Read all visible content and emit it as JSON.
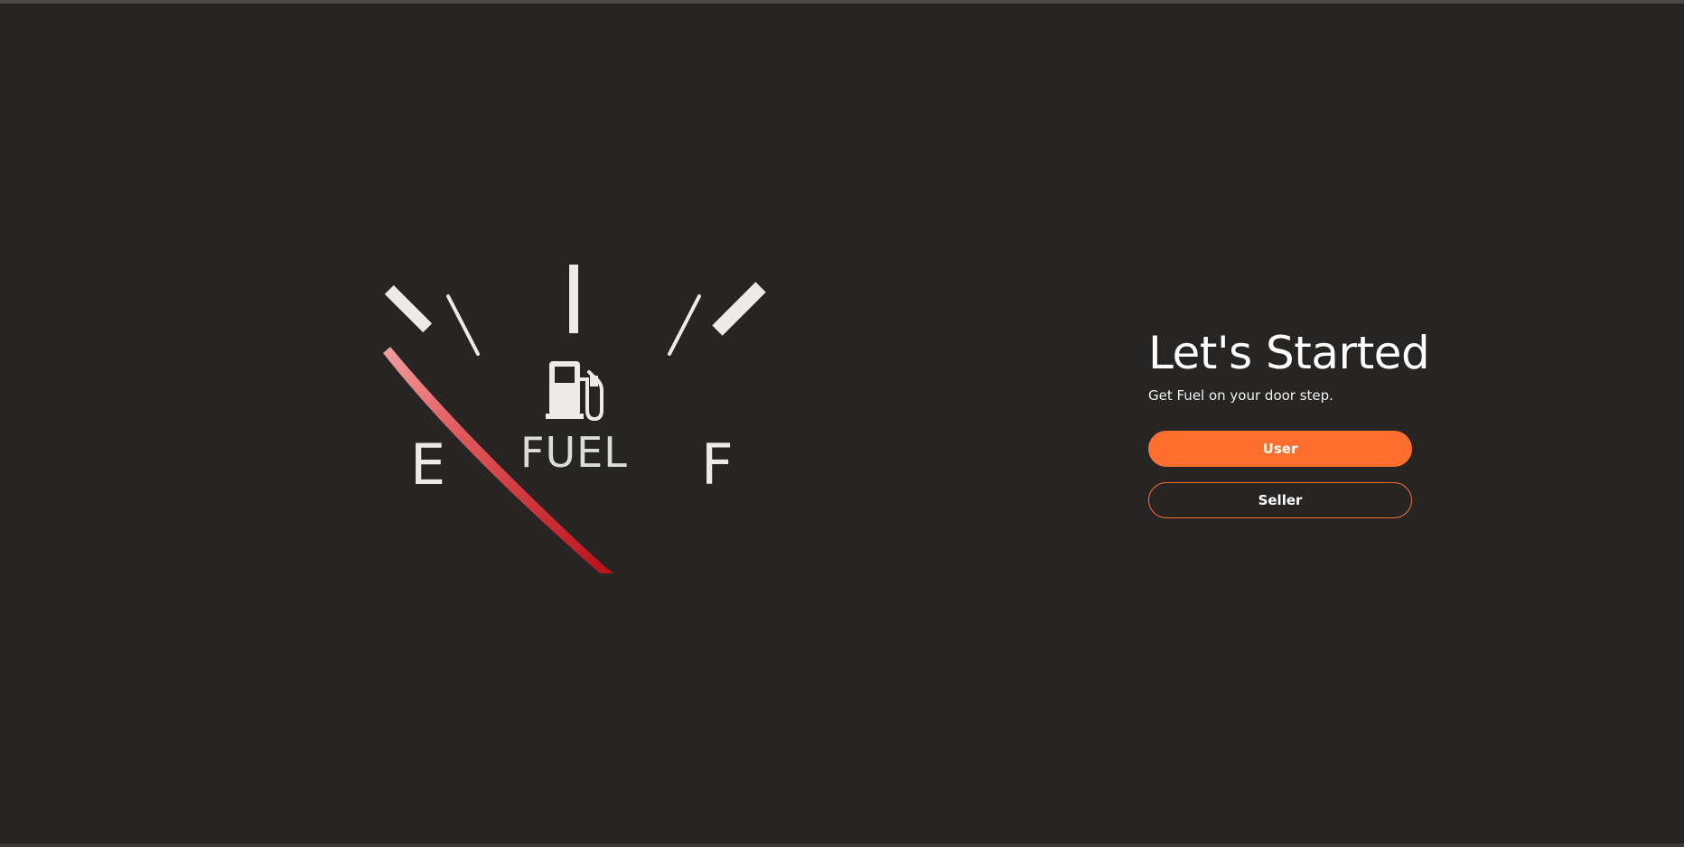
{
  "gauge": {
    "empty_label": "E",
    "full_label": "F",
    "center_label": "FUEL",
    "icon": "fuel-pump-icon",
    "fuel_level_fraction": 0.0,
    "needle_color": "#d4202a"
  },
  "panel": {
    "title": "Let's Started",
    "subtitle": "Get Fuel on your door step.",
    "user_button_label": "User",
    "seller_button_label": "Seller"
  },
  "colors": {
    "background": "#262524",
    "accent": "#ff6e2c",
    "text": "#ffffff"
  }
}
